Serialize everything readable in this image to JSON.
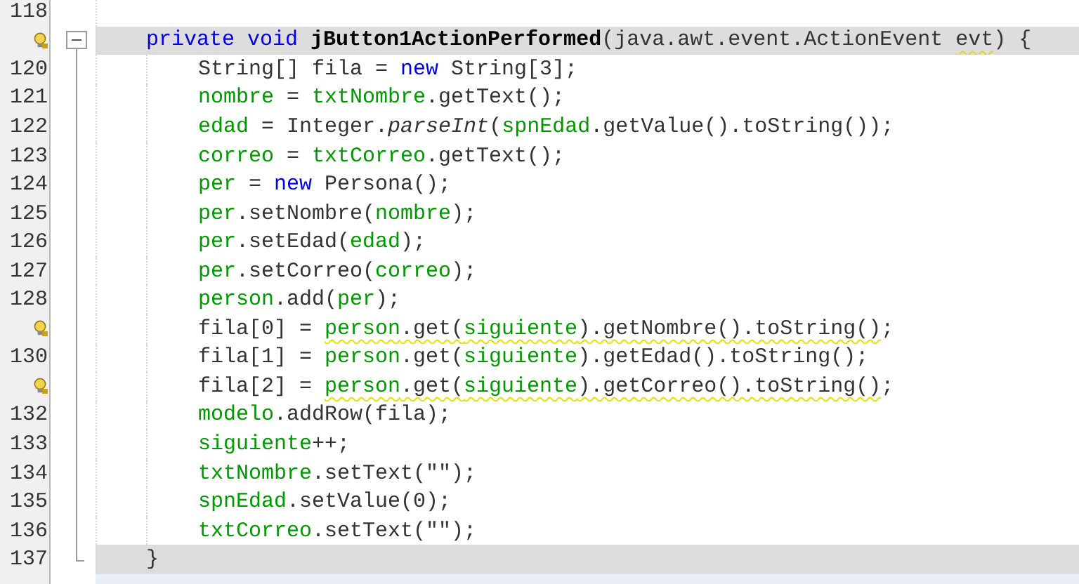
{
  "lines": [
    {
      "number": "118",
      "hint": false,
      "highlighted": false
    },
    {
      "hint": true,
      "highlighted": true,
      "expanded": true,
      "tokens": [
        {
          "text": "private void",
          "kind": "keyword"
        },
        {
          "text": " jButton1ActionPerformed",
          "kind": "declaration"
        },
        {
          "text": "(java.awt.event.ActionEvent ",
          "kind": "plain"
        },
        {
          "text": "evt",
          "kind": "plain",
          "warning": true
        },
        {
          "text": ") {",
          "kind": "plain"
        }
      ],
      "children": [
        {
          "number": "120",
          "hint": false,
          "highlighted": false,
          "tokens": [
            {
              "text": "String[] fila = ",
              "kind": "plain"
            },
            {
              "text": "new",
              "kind": "keyword"
            },
            {
              "text": " String[3];",
              "kind": "plain"
            }
          ]
        },
        {
          "number": "121",
          "hint": false,
          "highlighted": false,
          "tokens": [
            {
              "text": "nombre",
              "kind": "field"
            },
            {
              "text": " = ",
              "kind": "plain"
            },
            {
              "text": "txtNombre",
              "kind": "field"
            },
            {
              "text": ".getText();",
              "kind": "plain"
            }
          ]
        },
        {
          "number": "122",
          "hint": false,
          "highlighted": false,
          "tokens": [
            {
              "text": "edad",
              "kind": "field"
            },
            {
              "text": " = Integer.",
              "kind": "plain"
            },
            {
              "text": "parseInt",
              "kind": "static"
            },
            {
              "text": "(",
              "kind": "plain"
            },
            {
              "text": "spnEdad",
              "kind": "field"
            },
            {
              "text": ".getValue().toString());",
              "kind": "plain"
            }
          ]
        },
        {
          "number": "123",
          "hint": false,
          "highlighted": false,
          "tokens": [
            {
              "text": "correo",
              "kind": "field"
            },
            {
              "text": " = ",
              "kind": "plain"
            },
            {
              "text": "txtCorreo",
              "kind": "field"
            },
            {
              "text": ".getText();",
              "kind": "plain"
            }
          ]
        },
        {
          "number": "124",
          "hint": false,
          "highlighted": false,
          "tokens": [
            {
              "text": "per",
              "kind": "field"
            },
            {
              "text": " = ",
              "kind": "plain"
            },
            {
              "text": "new",
              "kind": "keyword"
            },
            {
              "text": " Persona();",
              "kind": "plain"
            }
          ]
        },
        {
          "number": "125",
          "hint": false,
          "highlighted": false,
          "tokens": [
            {
              "text": "per",
              "kind": "field"
            },
            {
              "text": ".setNombre(",
              "kind": "plain"
            },
            {
              "text": "nombre",
              "kind": "field"
            },
            {
              "text": ");",
              "kind": "plain"
            }
          ]
        },
        {
          "number": "126",
          "hint": false,
          "highlighted": false,
          "tokens": [
            {
              "text": "per",
              "kind": "field"
            },
            {
              "text": ".setEdad(",
              "kind": "plain"
            },
            {
              "text": "edad",
              "kind": "field"
            },
            {
              "text": ");",
              "kind": "plain"
            }
          ]
        },
        {
          "number": "127",
          "hint": false,
          "highlighted": false,
          "tokens": [
            {
              "text": "per",
              "kind": "field"
            },
            {
              "text": ".setCorreo(",
              "kind": "plain"
            },
            {
              "text": "correo",
              "kind": "field"
            },
            {
              "text": ");",
              "kind": "plain"
            }
          ]
        },
        {
          "number": "128",
          "hint": false,
          "highlighted": false,
          "tokens": [
            {
              "text": "person",
              "kind": "field"
            },
            {
              "text": ".add(",
              "kind": "plain"
            },
            {
              "text": "per",
              "kind": "field"
            },
            {
              "text": ");",
              "kind": "plain"
            }
          ]
        },
        {
          "hint": true,
          "highlighted": false,
          "tokens": [
            {
              "text": "fila[0] = ",
              "kind": "plain"
            },
            {
              "text": "person",
              "kind": "field",
              "warning": true
            },
            {
              "text": ".get(",
              "kind": "plain",
              "warning": true
            },
            {
              "text": "siguiente",
              "kind": "field",
              "warning": true
            },
            {
              "text": ").getNombre().toString()",
              "kind": "plain",
              "warning": true
            },
            {
              "text": ";",
              "kind": "plain"
            }
          ]
        },
        {
          "number": "130",
          "hint": false,
          "highlighted": false,
          "tokens": [
            {
              "text": "fila[1] = ",
              "kind": "plain"
            },
            {
              "text": "person",
              "kind": "field"
            },
            {
              "text": ".get(",
              "kind": "plain"
            },
            {
              "text": "siguiente",
              "kind": "field"
            },
            {
              "text": ").getEdad().toString();",
              "kind": "plain"
            }
          ]
        },
        {
          "hint": true,
          "highlighted": false,
          "tokens": [
            {
              "text": "fila[2] = ",
              "kind": "plain"
            },
            {
              "text": "person",
              "kind": "field",
              "warning": true
            },
            {
              "text": ".get(",
              "kind": "plain",
              "warning": true
            },
            {
              "text": "siguiente",
              "kind": "field",
              "warning": true
            },
            {
              "text": ").getCorreo().toString()",
              "kind": "plain",
              "warning": true
            },
            {
              "text": ";",
              "kind": "plain"
            }
          ]
        },
        {
          "number": "132",
          "hint": false,
          "highlighted": false,
          "tokens": [
            {
              "text": "modelo",
              "kind": "field"
            },
            {
              "text": ".addRow(fila);",
              "kind": "plain"
            }
          ]
        },
        {
          "number": "133",
          "hint": false,
          "highlighted": false,
          "tokens": [
            {
              "text": "siguiente",
              "kind": "field"
            },
            {
              "text": "++;",
              "kind": "plain"
            }
          ]
        },
        {
          "number": "134",
          "hint": false,
          "highlighted": false,
          "tokens": [
            {
              "text": "txtNombre",
              "kind": "field"
            },
            {
              "text": ".setText(\"\");",
              "kind": "plain"
            }
          ]
        },
        {
          "number": "135",
          "hint": false,
          "highlighted": false,
          "tokens": [
            {
              "text": "spnEdad",
              "kind": "field"
            },
            {
              "text": ".setValue(0);",
              "kind": "plain"
            }
          ]
        },
        {
          "number": "136",
          "hint": false,
          "highlighted": false,
          "tokens": [
            {
              "text": "txtCorreo",
              "kind": "field"
            },
            {
              "text": ".setText(\"\");",
              "kind": "plain"
            }
          ]
        }
      ]
    },
    {
      "number": "137",
      "hint": false,
      "highlighted": true,
      "tokens": [
        {
          "text": "}",
          "kind": "plain"
        }
      ]
    }
  ]
}
